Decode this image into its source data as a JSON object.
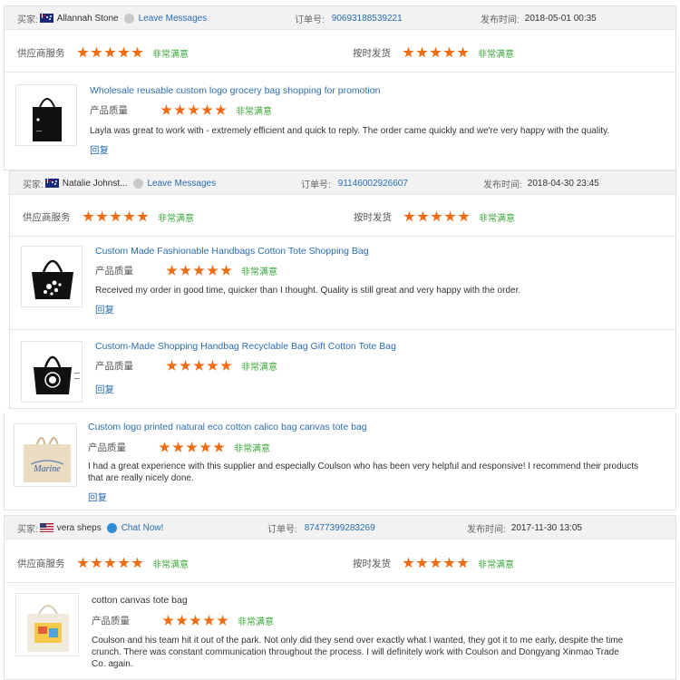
{
  "labels": {
    "buyer": "买家:",
    "order": "订单号:",
    "published": "发布时间:",
    "supplier_service": "供应商服务",
    "on_time": "按时发货",
    "product_quality": "产品质量",
    "verdict": "非常满意",
    "reply": "回复"
  },
  "colors": {
    "star": "#f06b12",
    "link": "#2a6db0",
    "verdict": "#3aa63a",
    "header_bg": "#f2f2f2"
  },
  "reviews": [
    {
      "buyer": "Allannah Stone",
      "flag": "australia-flag",
      "contact": "Leave Messages",
      "order_no": "90693188539221",
      "time": "2018-05-01 00:35",
      "supplier_stars": 5,
      "delivery_stars": 5,
      "products": [
        {
          "title": "Wholesale reusable custom logo grocery bag shopping for promotion",
          "quality_stars": 5,
          "comment": "Layla was great to work with - extremely efficient and quick to reply. The order came quickly and we're very happy with the quality."
        }
      ]
    },
    {
      "buyer": "Natalie Johnst...",
      "flag": "australia-flag",
      "contact": "Leave Messages",
      "order_no": "91146002926607",
      "time": "2018-04-30 23:45",
      "supplier_stars": 5,
      "delivery_stars": 5,
      "products": [
        {
          "title": "Custom Made Fashionable Handbags Cotton Tote Shopping Bag",
          "quality_stars": 5,
          "comment": "Received my order in good time, quicker than I thought. Quality is still great and very happy with the order."
        },
        {
          "title": "Custom-Made Shopping Handbag Recyclable Bag Gift Cotton Tote Bag",
          "quality_stars": 5,
          "comment": ""
        }
      ]
    },
    {
      "products": [
        {
          "title": "Custom logo printed natural eco cotton calico bag canvas tote bag",
          "quality_stars": 5,
          "comment": "I had a great experience with this supplier and especially Coulson who has been very helpful and responsive! I recommend their products that are really nicely done.",
          "bag_print": "Marine"
        }
      ]
    },
    {
      "buyer": "vera sheps",
      "flag": "usa-flag",
      "contact": "Chat Now!",
      "order_no": "87477399283269",
      "time": "2017-11-30 13:05",
      "supplier_stars": 5,
      "delivery_stars": 5,
      "products": [
        {
          "title": "cotton canvas tote bag",
          "quality_stars": 5,
          "comment": "Coulson and his team hit it out of the park. Not only did they send over exactly what I wanted, they got it to me early, despite the time crunch. There was constant communication throughout the process. I will definitely work with Coulson and Dongyang Xinmao Trade Co. again."
        }
      ]
    }
  ]
}
